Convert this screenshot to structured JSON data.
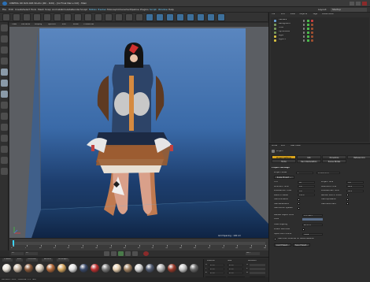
{
  "window": {
    "title": "CINEMA 4D R20.026 Studio (RC - R20) - [Gl Final Naru.c4d] - Main",
    "app_icon": "cinema4d-logo"
  },
  "menu": {
    "items": [
      "File",
      "Edit",
      "Create",
      "Select",
      "Tools",
      "Mesh",
      "Snap",
      "Animate",
      "Simulate",
      "Render",
      "Sculpt",
      "Motion Tracker",
      "MoGraph",
      "Character",
      "Pipeline",
      "Plugins",
      "Script",
      "Window",
      "Help"
    ],
    "accent_items": [
      "Motion Tracker",
      "Script",
      "Window"
    ],
    "layout_label": "Layout:",
    "layout_value": "Startup"
  },
  "viewport": {
    "menu": [
      "View",
      "Cameras",
      "Display",
      "Options",
      "Filter",
      "Panel",
      "ProRender"
    ],
    "grid_spacing": "Grid Spacing : 100 cm"
  },
  "timeline": {
    "ticks": [
      "0",
      "5",
      "10",
      "15",
      "20",
      "25",
      "30",
      "35",
      "40",
      "45",
      "50",
      "55",
      "60",
      "65",
      "70",
      "75",
      "80",
      "85",
      "90"
    ],
    "start_frame": "0 F",
    "end_frame": "90 F",
    "current_frame": "0 F"
  },
  "materials": {
    "tabs": [
      "Create",
      "Edit",
      "Function",
      "Texture",
      "MoGraph"
    ],
    "balls": [
      "#e8e2d8",
      "#c9b7a3",
      "#8b5a3a",
      "#d6c9b8",
      "#b46a3a",
      "#d8a860",
      "#e0e0e0",
      "#3a4a6a",
      "#c03030",
      "#7a7a7a",
      "#e8d0b0",
      "#a08060",
      "#d4d4d4",
      "#505a70",
      "#b0b0b0",
      "#9a3a2a",
      "#c8c8c8",
      "#6a6a6a"
    ],
    "coords_labels": [
      "Position",
      "Size",
      "Rotation"
    ],
    "axes": [
      "X",
      "Y",
      "Z"
    ],
    "values": [
      "0 cm",
      "0 cm",
      "0 cm"
    ],
    "h_p_b": [
      "H",
      "P",
      "B"
    ],
    "apply_button": "Apply",
    "mode_select": "Object (Rel)",
    "size_select": "Size"
  },
  "status": {
    "text": "Azimuth: 36.6°, Altitude: 1.3°  NW"
  },
  "object_manager": {
    "tabs": [
      "File",
      "Edit",
      "View",
      "Objects",
      "Tags",
      "Bookmarks"
    ],
    "objects": [
      {
        "name": "Camera",
        "color": "#6aa0d8"
      },
      {
        "name": "Background",
        "color": "#7a9a5a"
      },
      {
        "name": "Floor",
        "color": "#7a9a5a"
      },
      {
        "name": "Cyclorama",
        "color": "#7a9a5a"
      },
      {
        "name": "Light",
        "color": "#d8c040"
      },
      {
        "name": "Light.1",
        "color": "#d8c040"
      }
    ]
  },
  "attributes": {
    "tabs": [
      "Mode",
      "Edit",
      "User Data"
    ],
    "section": "Project",
    "subtabs": [
      "Project Settings",
      "Info",
      "Dynamics",
      "Referencing",
      "To Do",
      "Key Interpolation",
      "Scene Nodes"
    ],
    "heading": "Project Settings",
    "scale_label": "Project Scale",
    "scale_value": "1",
    "scale_unit": "Centimeters",
    "scale_button": "Scale Project ...",
    "rows_left": [
      {
        "label": "FPS",
        "value": "30"
      },
      {
        "label": "Minimum Time",
        "value": "0 F"
      },
      {
        "label": "Preview Min Time",
        "value": "0 F"
      },
      {
        "label": "Level of Detail",
        "value": "100 %"
      },
      {
        "label": "Use Animation",
        "value": ""
      },
      {
        "label": "Use Generators",
        "value": ""
      },
      {
        "label": "Use Motion System",
        "value": ""
      }
    ],
    "rows_right": [
      {
        "label": "Project Time",
        "value": "0 F"
      },
      {
        "label": "Maximum Time",
        "value": "90 F"
      },
      {
        "label": "Preview Max Time",
        "value": "90 F"
      },
      {
        "label": "Render LOD in Editor",
        "value": ""
      },
      {
        "label": "Use Expression",
        "value": ""
      },
      {
        "label": "Use Deformers",
        "value": ""
      }
    ],
    "default_color_label": "Default Object Color",
    "default_color_value": "Gray Blue",
    "color_label": "Color",
    "view_clipping_label": "View Clipping",
    "view_clipping_value": "Medium",
    "linear_workflow_label": "Linear Workflow",
    "input_color_label": "Input Color Profile",
    "input_color_value": "sRGB",
    "use_color_channel_label": "Use Color Channel for Node Material",
    "load_preset_button": "Load Preset...",
    "save_preset_button": "Save Preset..."
  }
}
